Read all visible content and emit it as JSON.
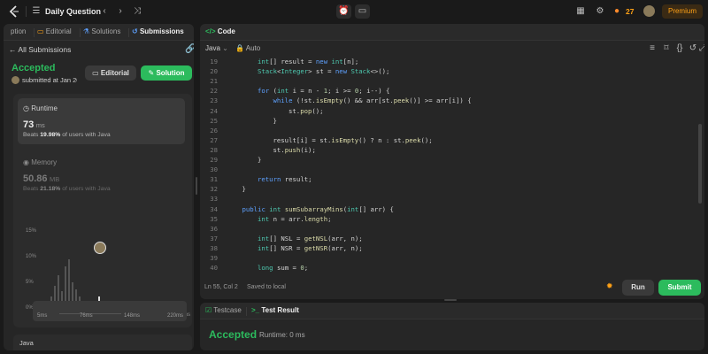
{
  "topbar": {
    "title": "Daily Question",
    "streak": "27",
    "premium": "Premium"
  },
  "left": {
    "tabs": [
      "ption",
      "Editorial",
      "Solutions",
      "Submissions"
    ],
    "back_label": "All Submissions",
    "status": "Accepted",
    "submitted": "submitted at Jan 20",
    "editorial_btn": "Editorial",
    "solution_btn": "Solution",
    "runtime_label": "Runtime",
    "runtime_value": "73",
    "runtime_unit": "ms",
    "runtime_beats_pre": "Beats",
    "runtime_beats_pct": "19.98%",
    "runtime_beats_post": "of users with Java",
    "memory_label": "Memory",
    "memory_value": "50.86",
    "memory_unit": "MB",
    "memory_beats_pre": "Beats",
    "memory_beats_pct": "21.18%",
    "memory_beats_post": "of users with Java",
    "yticks": [
      "15%",
      "10%",
      "5%",
      "0%"
    ],
    "xticks": [
      "5ms",
      "76ms",
      "148ms",
      "220ms"
    ],
    "mini_xticks": [
      "5ms",
      "76ms",
      "148ms",
      "220ms"
    ],
    "lang_footer": "Java"
  },
  "editor": {
    "tab_label": "Code",
    "language": "Java",
    "autocomplete": "Auto",
    "status": "Ln 55, Col 2",
    "saved": "Saved to local",
    "run_btn": "Run",
    "submit_btn": "Submit"
  },
  "code_lines": [
    {
      "n": "19",
      "i": 2,
      "t": [
        [
          "ty",
          "int"
        ],
        [
          "id",
          "[] result = "
        ],
        [
          "kw",
          "new"
        ],
        [
          "ty",
          " int"
        ],
        [
          "id",
          "[n];"
        ]
      ]
    },
    {
      "n": "20",
      "i": 2,
      "t": [
        [
          "ty",
          "Stack"
        ],
        [
          "id",
          "<"
        ],
        [
          "ty",
          "Integer"
        ],
        [
          "id",
          "> st = "
        ],
        [
          "kw",
          "new"
        ],
        [
          "ty",
          " Stack"
        ],
        [
          "id",
          "<>();"
        ]
      ]
    },
    {
      "n": "21",
      "i": 0,
      "t": []
    },
    {
      "n": "22",
      "i": 2,
      "t": [
        [
          "kw",
          "for"
        ],
        [
          "id",
          " ("
        ],
        [
          "ty",
          "int"
        ],
        [
          "id",
          " i = n - "
        ],
        [
          "num",
          "1"
        ],
        [
          "id",
          "; i >= "
        ],
        [
          "num",
          "0"
        ],
        [
          "id",
          "; i--) {"
        ]
      ]
    },
    {
      "n": "23",
      "i": 3,
      "t": [
        [
          "kw",
          "while"
        ],
        [
          "id",
          " (!st."
        ],
        [
          "fn",
          "isEmpty"
        ],
        [
          "id",
          "() && arr[st."
        ],
        [
          "fn",
          "peek"
        ],
        [
          "id",
          "()] >= arr[i]) {"
        ]
      ]
    },
    {
      "n": "24",
      "i": 4,
      "t": [
        [
          "id",
          "st."
        ],
        [
          "fn",
          "pop"
        ],
        [
          "id",
          "();"
        ]
      ]
    },
    {
      "n": "25",
      "i": 3,
      "t": [
        [
          "id",
          "}"
        ]
      ]
    },
    {
      "n": "26",
      "i": 0,
      "t": []
    },
    {
      "n": "27",
      "i": 3,
      "t": [
        [
          "id",
          "result[i] = st."
        ],
        [
          "fn",
          "isEmpty"
        ],
        [
          "id",
          "() ? n : st."
        ],
        [
          "fn",
          "peek"
        ],
        [
          "id",
          "();"
        ]
      ]
    },
    {
      "n": "28",
      "i": 3,
      "t": [
        [
          "id",
          "st."
        ],
        [
          "fn",
          "push"
        ],
        [
          "id",
          "(i);"
        ]
      ]
    },
    {
      "n": "29",
      "i": 2,
      "t": [
        [
          "id",
          "}"
        ]
      ]
    },
    {
      "n": "30",
      "i": 0,
      "t": []
    },
    {
      "n": "31",
      "i": 2,
      "t": [
        [
          "kw",
          "return"
        ],
        [
          "id",
          " result;"
        ]
      ]
    },
    {
      "n": "32",
      "i": 1,
      "t": [
        [
          "id",
          "}"
        ]
      ]
    },
    {
      "n": "33",
      "i": 0,
      "t": []
    },
    {
      "n": "34",
      "i": 1,
      "t": [
        [
          "kw",
          "public"
        ],
        [
          "ty",
          " int"
        ],
        [
          "fn",
          " sumSubarrayMins"
        ],
        [
          "id",
          "("
        ],
        [
          "ty",
          "int"
        ],
        [
          "id",
          "[] arr) {"
        ]
      ]
    },
    {
      "n": "35",
      "i": 2,
      "t": [
        [
          "ty",
          "int"
        ],
        [
          "id",
          " n = arr."
        ],
        [
          "fn",
          "length"
        ],
        [
          "id",
          ";"
        ]
      ]
    },
    {
      "n": "36",
      "i": 0,
      "t": []
    },
    {
      "n": "37",
      "i": 2,
      "t": [
        [
          "ty",
          "int"
        ],
        [
          "id",
          "[] NSL = "
        ],
        [
          "fn",
          "getNSL"
        ],
        [
          "id",
          "(arr, n);"
        ]
      ]
    },
    {
      "n": "38",
      "i": 2,
      "t": [
        [
          "ty",
          "int"
        ],
        [
          "id",
          "[] NSR = "
        ],
        [
          "fn",
          "getNSR"
        ],
        [
          "id",
          "(arr, n);"
        ]
      ]
    },
    {
      "n": "39",
      "i": 0,
      "t": []
    },
    {
      "n": "40",
      "i": 2,
      "t": [
        [
          "ty",
          "long"
        ],
        [
          "id",
          " sum = "
        ],
        [
          "num",
          "0"
        ],
        [
          "id",
          ";"
        ]
      ]
    }
  ],
  "result": {
    "testcase_tab": "Testcase",
    "result_tab": "Test Result",
    "status": "Accepted",
    "runtime": "Runtime: 0 ms"
  },
  "colors": {
    "accent_green": "#2cbb5d",
    "premium_orange": "#ffa116",
    "background": "#1a1a1a",
    "panel": "#262626"
  }
}
